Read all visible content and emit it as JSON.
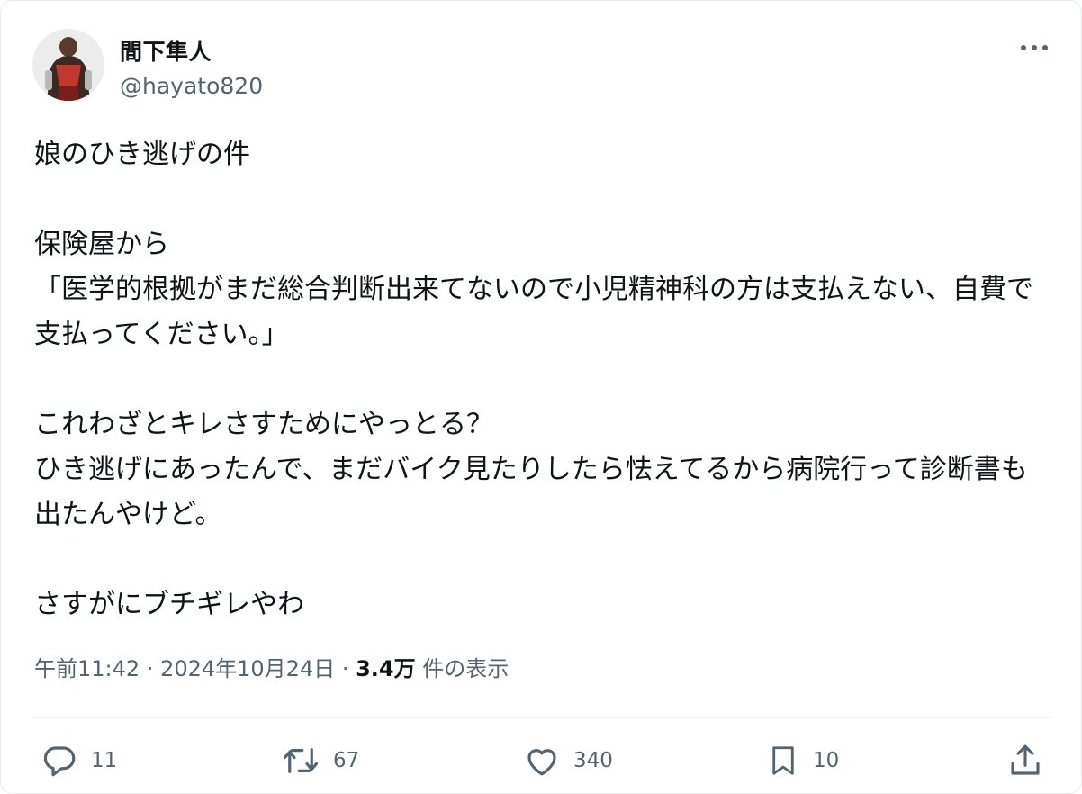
{
  "author": {
    "name": "間下隼人",
    "handle": "@hayato820"
  },
  "tweet": {
    "lines": [
      "娘のひき逃げの件",
      "",
      "保険屋から",
      "「医学的根拠がまだ総合判断出来てないので小児精神科の方は支払えない、自費で支払ってください。」",
      "",
      "これわざとキレさすためにやっとる？",
      "ひき逃げにあったんで、まだバイク見たりしたら怯えてるから病院行って診断書も出たんやけど。",
      "",
      "さすがにブチギレやわ"
    ]
  },
  "meta": {
    "time": "午前11:42",
    "sep1": " · ",
    "date": "2024年10月24日",
    "sep2": " · ",
    "views": "3.4万",
    "views_suffix": " 件の表示"
  },
  "actions": {
    "reply_count": "11",
    "retweet_count": "67",
    "like_count": "340",
    "bookmark_count": "10"
  },
  "icons": [
    "avatar",
    "more-icon",
    "reply-icon",
    "retweet-icon",
    "like-icon",
    "bookmark-icon",
    "share-icon"
  ],
  "colors": {
    "text": "#0f1419",
    "secondary": "#536471",
    "icon": "#536471"
  }
}
